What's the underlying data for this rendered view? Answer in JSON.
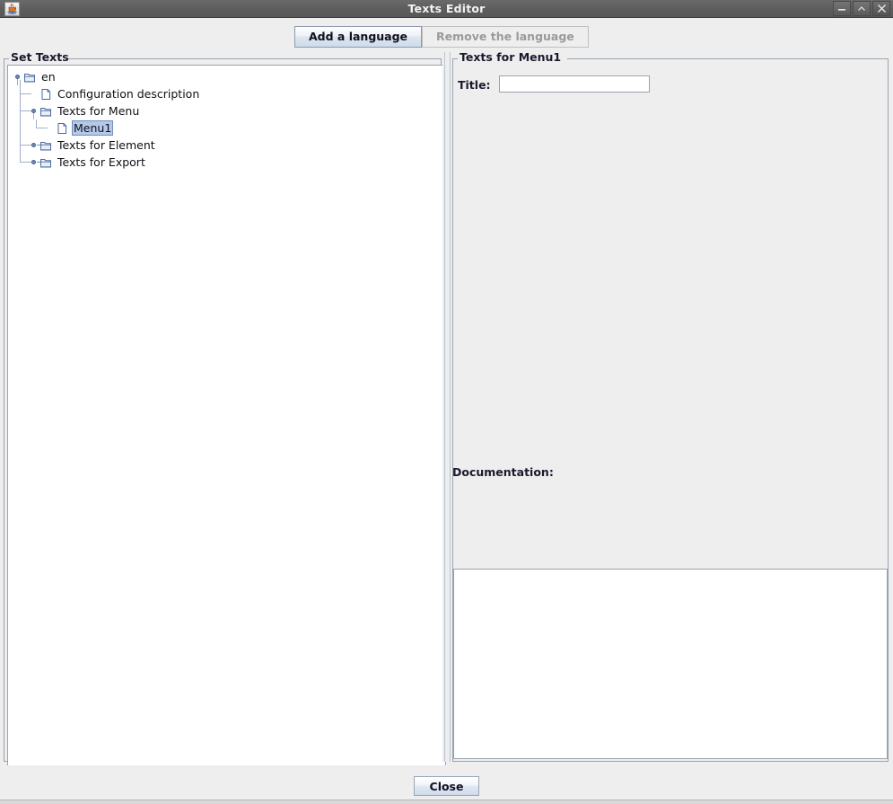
{
  "window": {
    "title": "Texts Editor",
    "app_icon": "java-coffee-cup-icon",
    "controls": {
      "minimize": "–",
      "maximize": "⌃",
      "close": "✕"
    }
  },
  "toolbar": {
    "add_language_label": "Add a language",
    "remove_language_label": "Remove the language",
    "remove_language_enabled": false
  },
  "left_panel": {
    "legend": "Set Texts",
    "tree": [
      {
        "label": "en",
        "icon": "folder-icon",
        "depth": 0,
        "handle": "expanded",
        "selected": false
      },
      {
        "label": "Configuration description",
        "icon": "file-icon",
        "depth": 1,
        "handle": "none",
        "selected": false
      },
      {
        "label": "Texts for Menu",
        "icon": "folder-icon",
        "depth": 1,
        "handle": "expanded",
        "selected": false
      },
      {
        "label": "Menu1",
        "icon": "file-icon",
        "depth": 2,
        "handle": "none",
        "selected": true
      },
      {
        "label": "Texts for Element",
        "icon": "folder-icon",
        "depth": 1,
        "handle": "collapsed",
        "selected": false
      },
      {
        "label": "Texts for Export",
        "icon": "folder-icon",
        "depth": 1,
        "handle": "collapsed",
        "selected": false
      }
    ]
  },
  "right_panel": {
    "legend": "Texts for Menu1",
    "title_label": "Title:",
    "title_value": "",
    "title_placeholder": "",
    "documentation_label": "Documentation:",
    "documentation_value": "",
    "documentation_placeholder": ""
  },
  "footer": {
    "close_label": "Close"
  },
  "colors": {
    "titlebar": "#5e5e5e",
    "window_bg": "#eeeeee",
    "panel_border": "#9aa4b0",
    "selection": "#b4c8e8",
    "selection_border": "#6f8fbf",
    "tree_icon_blue": "#6e8cb8",
    "button_accent": "#cfdceb",
    "disabled_text": "#9a9a9a"
  }
}
